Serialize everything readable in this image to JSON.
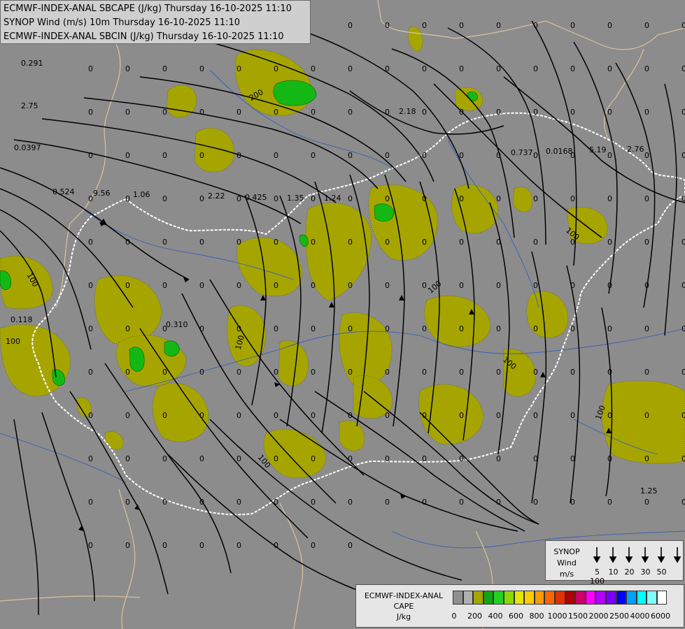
{
  "title_lines": [
    "ECMWF-INDEX-ANAL SBCAPE (J/kg) Thursday 16-10-2025 11:10",
    "SYNOP Wind (m/s) 10m Thursday 16-10-2025 11:10",
    "ECMWF-INDEX-ANAL SBCIN (J/kg) Thursday 16-10-2025 11:10"
  ],
  "colors": {
    "background": "#8c8c8c",
    "cape_100": "#a6a500",
    "cape_400": "#14b814",
    "border_country": "#ffffff",
    "border_region": "#d8c4a0",
    "streamline": "#000000"
  },
  "map_labels": [
    "0.291",
    "2.75",
    "0.0397",
    "0.524",
    "9.56",
    "1.06",
    "2.22",
    "0.425",
    "1.35",
    "1.24",
    "2.18",
    "0.737",
    "0.0168",
    "5.19",
    "2.76",
    "0.118",
    "0.310",
    "1.25",
    "200",
    "100"
  ],
  "zero_label": "0",
  "wind_legend": {
    "title": "SYNOP",
    "name": "Wind",
    "unit": "m/s",
    "speeds": [
      "5",
      "10",
      "20",
      "30",
      "50",
      "100"
    ]
  },
  "cape_legend": {
    "title": "ECMWF-INDEX-ANAL",
    "name": "CAPE",
    "unit": "J/kg",
    "colors": [
      "#909090",
      "#b0b0b0",
      "#a6a500",
      "#14a514",
      "#22d122",
      "#8cd800",
      "#e6e600",
      "#ffcc00",
      "#ff9900",
      "#ff6600",
      "#e23000",
      "#b00000",
      "#cc0066",
      "#ff00ff",
      "#b000ff",
      "#7a00ff",
      "#0000ff",
      "#00a0ff",
      "#00ffff",
      "#80ffff",
      "#ffffff"
    ],
    "ticks": [
      "0",
      "200",
      "400",
      "600",
      "800",
      "1000",
      "1500",
      "2000",
      "2500",
      "4000",
      "6000"
    ]
  }
}
